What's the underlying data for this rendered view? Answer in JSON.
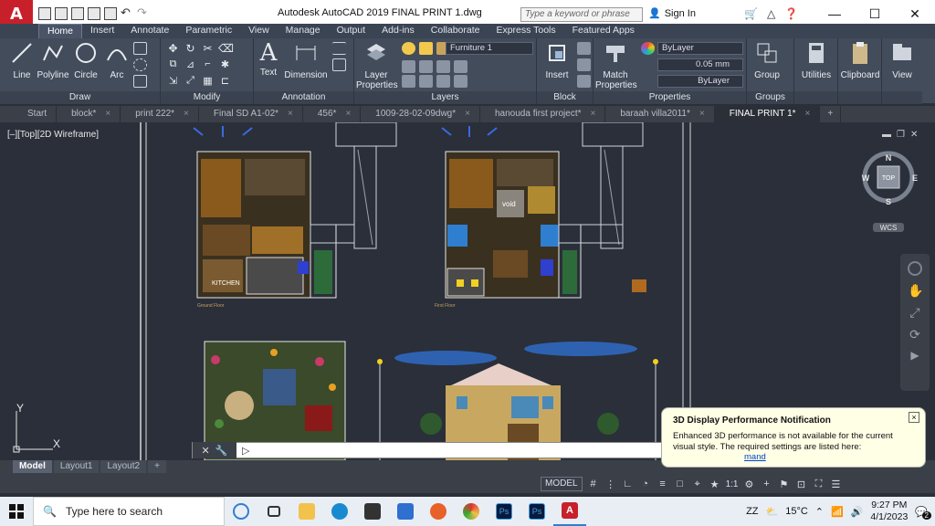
{
  "titlebar": {
    "app_letter": "A",
    "title": "Autodesk AutoCAD 2019     FINAL PRINT 1.dwg",
    "search_placeholder": "Type a keyword or phrase",
    "signin": "Sign In"
  },
  "ribbon_tabs": [
    "Home",
    "Insert",
    "Annotate",
    "Parametric",
    "View",
    "Manage",
    "Output",
    "Add-ins",
    "Collaborate",
    "Express Tools",
    "Featured Apps"
  ],
  "ribbon": {
    "draw": {
      "title": "Draw",
      "line": "Line",
      "polyline": "Polyline",
      "circle": "Circle",
      "arc": "Arc"
    },
    "modify": {
      "title": "Modify"
    },
    "annotation": {
      "title": "Annotation",
      "text": "Text",
      "dimension": "Dimension"
    },
    "layers": {
      "title": "Layers",
      "layer_properties_1": "Layer",
      "layer_properties_2": "Properties",
      "current_layer": "Furniture 1"
    },
    "block": {
      "title": "Block",
      "insert": "Insert"
    },
    "properties": {
      "title": "Properties",
      "match_1": "Match",
      "match_2": "Properties",
      "color": "ByLayer",
      "lineweight": "0.05 mm",
      "linetype": "ByLayer"
    },
    "groups": {
      "title": "Groups",
      "group": "Group"
    },
    "utilities": "Utilities",
    "clipboard": "Clipboard",
    "view": "View"
  },
  "doc_tabs": [
    {
      "label": "Start",
      "close": ""
    },
    {
      "label": "block*",
      "close": "×"
    },
    {
      "label": "print 222*",
      "close": "×"
    },
    {
      "label": "Final SD A1-02*",
      "close": "×"
    },
    {
      "label": "456*",
      "close": "×"
    },
    {
      "label": "1009-28-02-09dwg*",
      "close": "×"
    },
    {
      "label": "hanouda first project*",
      "close": "×"
    },
    {
      "label": "baraah villa2011*",
      "close": "×"
    },
    {
      "label": "FINAL PRINT 1*",
      "close": "×"
    }
  ],
  "canvas": {
    "viewport_label": "[–][Top][2D Wireframe]",
    "plan_label_1": "Ground Floor",
    "plan_label_2": "First Floor",
    "void_label": "void",
    "kitchen_label": "KITCHEN",
    "viewcube": {
      "n": "N",
      "s": "S",
      "e": "E",
      "w": "W",
      "top": "TOP",
      "wcs": "WCS"
    },
    "ucs_x": "X",
    "ucs_y": "Y"
  },
  "notification": {
    "title": "3D Display Performance Notification",
    "body": "Enhanced 3D performance is not available for the current visual style. The required settings are listed here:",
    "link": "mand",
    "close": "×"
  },
  "cmdline": {
    "prompt": ""
  },
  "layout_tabs": [
    "Model",
    "Layout1",
    "Layout2",
    "+"
  ],
  "status": {
    "model": "MODEL",
    "scale": "1:1"
  },
  "taskbar": {
    "search_placeholder": "Type here to search",
    "temperature": "15°C",
    "time": "9:27 PM",
    "date": "4/1/2023",
    "badge": "2",
    "zz": "ZZ"
  },
  "colors": {
    "ribbon_bg": "#434c5b",
    "canvas_bg": "#2a2f39",
    "autocad_red": "#c8202a",
    "accent_blue": "#2f8fdc"
  }
}
